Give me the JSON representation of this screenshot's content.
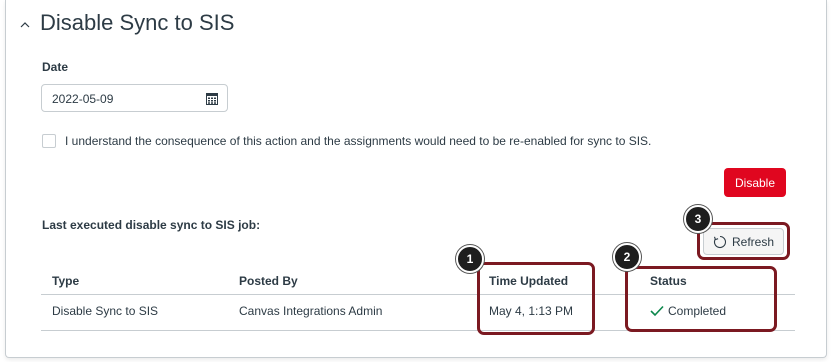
{
  "section": {
    "title": "Disable Sync to SIS"
  },
  "form": {
    "date_label": "Date",
    "date_value": "2022-05-09",
    "consent_label": "I understand the consequence of this action and the assignments would need to be re-enabled for sync to SIS.",
    "disable_label": "Disable"
  },
  "job": {
    "label": "Last executed disable sync to SIS job:",
    "refresh_label": "Refresh"
  },
  "table": {
    "headers": [
      "Type",
      "Posted By",
      "Time Updated",
      "Status"
    ],
    "rows": [
      [
        "Disable Sync to SIS",
        "Canvas Integrations Admin",
        "May 4, 1:13 PM",
        "Completed"
      ]
    ]
  },
  "callouts": [
    "1",
    "2",
    "3"
  ],
  "colors": {
    "disable_button": "#e0061f",
    "callout_border": "#7b1921",
    "status_check": "#0b874b",
    "text": "#2d3b45"
  },
  "icons": {
    "collapse": "chevron-up-icon",
    "calendar": "calendar-icon",
    "refresh": "refresh-icon",
    "status": "checkmark-icon"
  }
}
